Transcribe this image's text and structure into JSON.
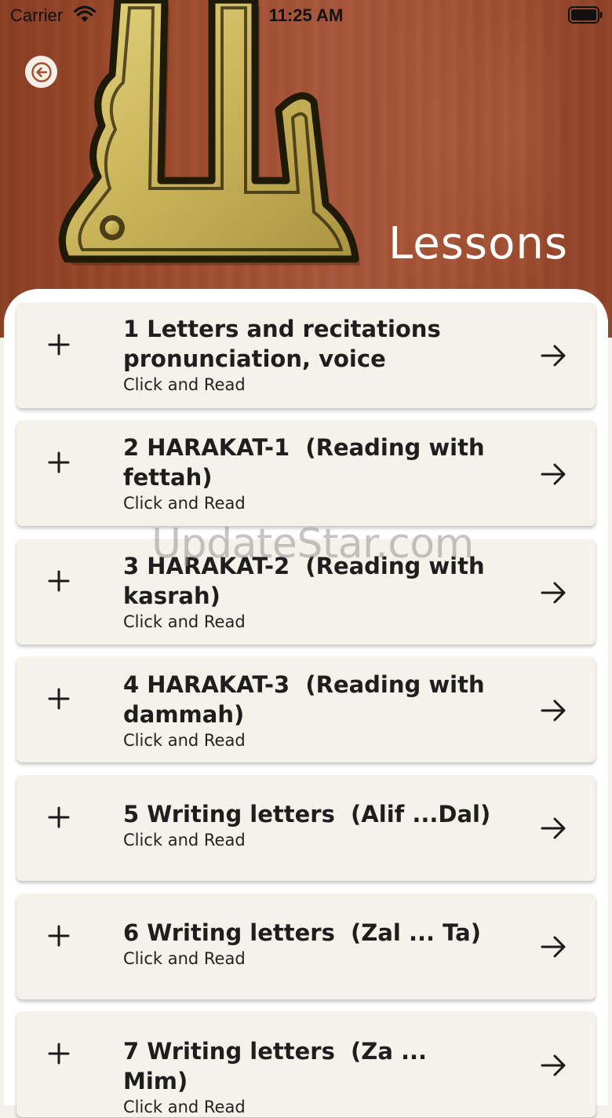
{
  "status_bar": {
    "carrier": "Carrier",
    "time": "11:25 AM",
    "wifi_icon": "wifi-icon",
    "battery_icon": "battery-full-icon"
  },
  "header": {
    "title": "Lessons",
    "back_icon": "arrow-left-circle-icon",
    "background_color": "#9c4a2c",
    "calligraphy_image": "allah-calligraphy-gold"
  },
  "lessons": [
    {
      "title": "1 Letters and recitations pronunciation, voice",
      "subtitle": "Click and Read",
      "expand_icon": "plus-icon",
      "open_icon": "arrow-right-icon"
    },
    {
      "title": "2 HARAKAT-1  (Reading with fettah)",
      "subtitle": "Click and Read",
      "expand_icon": "plus-icon",
      "open_icon": "arrow-right-icon"
    },
    {
      "title": "3 HARAKAT-2  (Reading with kasrah)",
      "subtitle": "Click and Read",
      "expand_icon": "plus-icon",
      "open_icon": "arrow-right-icon"
    },
    {
      "title": "4 HARAKAT-3  (Reading with dammah)",
      "subtitle": "Click and Read",
      "expand_icon": "plus-icon",
      "open_icon": "arrow-right-icon"
    },
    {
      "title": "5 Writing letters  (Alif ...Dal)",
      "subtitle": "Click and Read",
      "expand_icon": "plus-icon",
      "open_icon": "arrow-right-icon"
    },
    {
      "title": "6 Writing letters  (Zal ... Ta)",
      "subtitle": "Click and Read",
      "expand_icon": "plus-icon",
      "open_icon": "arrow-right-icon"
    },
    {
      "title": "7 Writing letters  (Za ... Mim)",
      "subtitle": "Click and Read",
      "expand_icon": "plus-icon",
      "open_icon": "arrow-right-icon"
    }
  ],
  "watermark": "UpdateStar.com",
  "colors": {
    "card_background": "#f5f1eb",
    "panel_background": "#ffffff",
    "text": "#1e1e1e"
  }
}
